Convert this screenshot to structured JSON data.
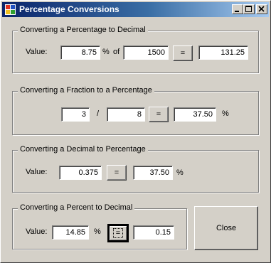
{
  "window": {
    "title": "Percentage Conversions"
  },
  "group1": {
    "title": "Converting a Percentage to Decimal",
    "value_label": "Value:",
    "value": "8.75",
    "percent_sign": "%",
    "of_label": "of",
    "of_value": "1500",
    "equals_label": "=",
    "result": "131.25"
  },
  "group2": {
    "title": "Converting a Fraction to a Percentage",
    "numerator": "3",
    "slash": "/",
    "denominator": "8",
    "equals_label": "=",
    "result": "37.50",
    "percent_sign": "%"
  },
  "group3": {
    "title": "Converting a Decimal to Percentage",
    "value_label": "Value:",
    "value": "0.375",
    "equals_label": "=",
    "result": "37.50",
    "percent_sign": "%"
  },
  "group4": {
    "title": "Converting a Percent to Decimal",
    "value_label": "Value:",
    "value": "14.85",
    "percent_sign": "%",
    "equals_label": "=",
    "result": "0.15"
  },
  "close_label": "Close"
}
